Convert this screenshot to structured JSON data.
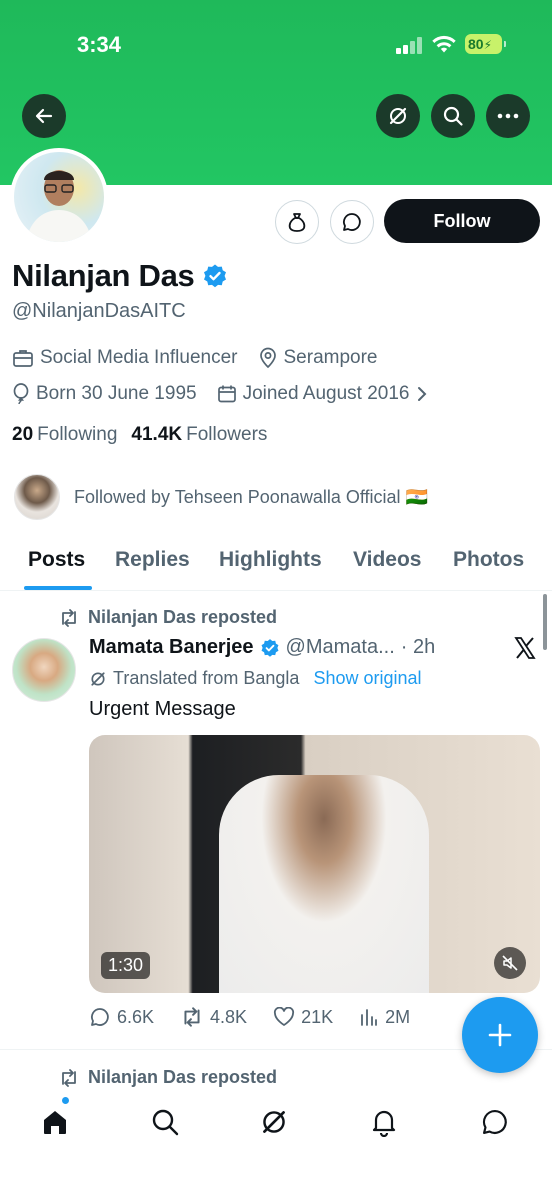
{
  "status_bar": {
    "time": "3:34",
    "battery": "80"
  },
  "profile": {
    "name": "Nilanjan Das",
    "handle": "@NilanjanDasAITC",
    "category": "Social Media Influencer",
    "location": "Serampore",
    "born": "Born 30 June 1995",
    "joined": "Joined August 2016",
    "following_count": "20",
    "following_label": "Following",
    "followers_count": "41.4K",
    "followers_label": "Followers",
    "followed_by": "Followed by Tehseen Poonawalla Official 🇮🇳",
    "follow_button": "Follow"
  },
  "tabs": [
    "Posts",
    "Replies",
    "Highlights",
    "Videos",
    "Photos"
  ],
  "active_tab": "Posts",
  "post": {
    "reposted_by": "Nilanjan Das reposted",
    "author": "Mamata Banerjee",
    "author_handle": "@Mamata...",
    "time": "· 2h",
    "translated": "Translated from Bangla",
    "show_original": "Show original",
    "text": "Urgent Message",
    "video_duration": "1:30",
    "replies": "6.6K",
    "reposts": "4.8K",
    "likes": "21K",
    "views": "2M"
  },
  "next_post": {
    "reposted_by": "Nilanjan Das reposted"
  },
  "colors": {
    "banner": "#22c663",
    "accent": "#1d9bf0",
    "text": "#0f1419",
    "muted": "#536471"
  }
}
